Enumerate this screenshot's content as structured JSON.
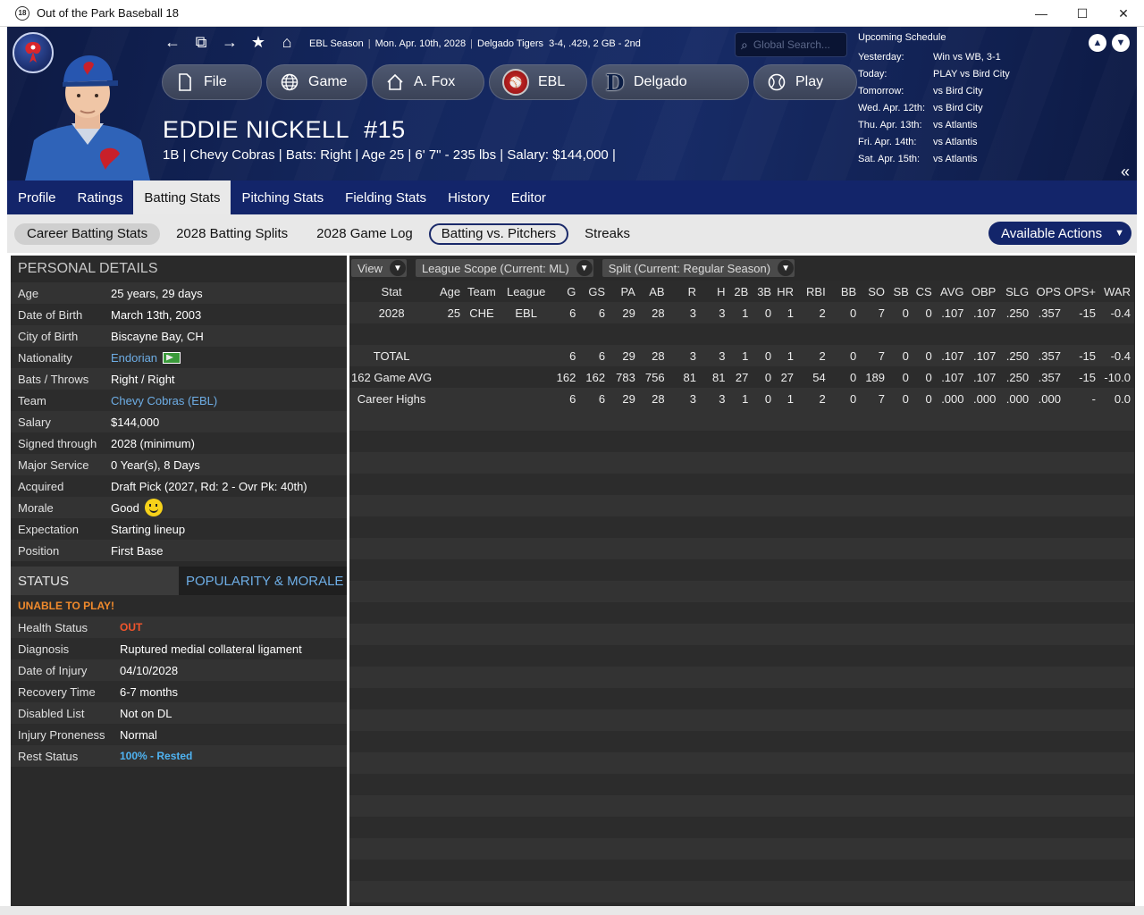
{
  "window": {
    "title": "Out of the Park Baseball 18",
    "app_badge": "18",
    "minimize": "—",
    "maximize": "☐",
    "close": "✕"
  },
  "header": {
    "season_label": "EBL Season",
    "date": "Mon. Apr. 10th, 2028",
    "team": "Delgado Tigers",
    "record": "3-4, .429, 2 GB - 2nd",
    "search_placeholder": "Global Search...",
    "menu": [
      {
        "label": "File",
        "icon": "file-icon"
      },
      {
        "label": "Game",
        "icon": "globe-icon"
      },
      {
        "label": "A. Fox",
        "icon": "home-icon"
      },
      {
        "label": "EBL",
        "icon": "league-logo-icon"
      },
      {
        "label": "Delgado",
        "icon": "tigers-logo-icon"
      },
      {
        "label": "Play",
        "icon": "baseball-icon"
      }
    ]
  },
  "player": {
    "name": "EDDIE NICKELL",
    "number": "#15",
    "info": "1B | Chevy Cobras  |  Bats: Right  |  Age 25  |  6' 7\" - 235 lbs  |  Salary: $144,000  |"
  },
  "schedule": {
    "title": "Upcoming Schedule",
    "rows": [
      {
        "day": "Yesterday:",
        "game": "Win vs WB, 3-1"
      },
      {
        "day": "Today:",
        "game": "PLAY vs Bird City"
      },
      {
        "day": "Tomorrow:",
        "game": "vs Bird City"
      },
      {
        "day": "Wed. Apr. 12th:",
        "game": "vs Bird City"
      },
      {
        "day": "Thu. Apr. 13th:",
        "game": "vs Atlantis"
      },
      {
        "day": "Fri. Apr. 14th:",
        "game": "vs Atlantis"
      },
      {
        "day": "Sat. Apr. 15th:",
        "game": "vs Atlantis"
      }
    ]
  },
  "tabs": [
    "Profile",
    "Ratings",
    "Batting Stats",
    "Pitching Stats",
    "Fielding Stats",
    "History",
    "Editor"
  ],
  "active_tab": "Batting Stats",
  "subtabs": [
    "Career Batting Stats",
    "2028 Batting Splits",
    "2028 Game Log",
    "Batting vs. Pitchers",
    "Streaks"
  ],
  "available_actions": "Available Actions",
  "personal": {
    "title": "PERSONAL DETAILS",
    "rows": [
      {
        "label": "Age",
        "value": "25 years, 29 days"
      },
      {
        "label": "Date of Birth",
        "value": "March 13th, 2003"
      },
      {
        "label": "City of Birth",
        "value": "Biscayne Bay, CH"
      },
      {
        "label": "Nationality",
        "value": "Endorian"
      },
      {
        "label": "Bats / Throws",
        "value": "Right / Right"
      },
      {
        "label": "Team",
        "value": "Chevy Cobras (EBL)"
      },
      {
        "label": "Salary",
        "value": "$144,000"
      },
      {
        "label": "Signed through",
        "value": "2028 (minimum)"
      },
      {
        "label": "Major Service",
        "value": "0 Year(s), 8 Days"
      },
      {
        "label": "Acquired",
        "value": "Draft Pick (2027, Rd: 2 - Ovr Pk: 40th)"
      },
      {
        "label": "Morale",
        "value": "Good"
      },
      {
        "label": "Expectation",
        "value": "Starting lineup"
      },
      {
        "label": "Position",
        "value": "First Base"
      }
    ]
  },
  "status": {
    "tab_status": "STATUS",
    "tab_popularity": "POPULARITY & MORALE",
    "alert": "UNABLE TO PLAY!",
    "rows": [
      {
        "label": "Health Status",
        "value": "OUT"
      },
      {
        "label": "Diagnosis",
        "value": "Ruptured medial collateral ligament"
      },
      {
        "label": "Date of Injury",
        "value": "04/10/2028"
      },
      {
        "label": "Recovery Time",
        "value": "6-7 months"
      },
      {
        "label": "Disabled List",
        "value": "Not on DL"
      },
      {
        "label": "Injury Proneness",
        "value": "Normal"
      },
      {
        "label": "Rest Status",
        "value": "100% - Rested"
      }
    ]
  },
  "filters": {
    "view": "View",
    "scope": "League Scope  (Current: ML)",
    "split": "Split  (Current: Regular Season)"
  },
  "stats": {
    "columns": [
      "Stat",
      "Age",
      "Team",
      "League",
      "G",
      "GS",
      "PA",
      "AB",
      "R",
      "H",
      "2B",
      "3B",
      "HR",
      "RBI",
      "BB",
      "SO",
      "SB",
      "CS",
      "AVG",
      "OBP",
      "SLG",
      "OPS",
      "OPS+",
      "WAR"
    ],
    "rows": [
      [
        "2028",
        "25",
        "CHE",
        "EBL",
        "6",
        "6",
        "29",
        "28",
        "3",
        "3",
        "1",
        "0",
        "1",
        "2",
        "0",
        "7",
        "0",
        "0",
        ".107",
        ".107",
        ".250",
        ".357",
        "-15",
        "-0.4"
      ],
      [
        "",
        "",
        "",
        "",
        "",
        "",
        "",
        "",
        "",
        "",
        "",
        "",
        "",
        "",
        "",
        "",
        "",
        "",
        "",
        "",
        "",
        "",
        "",
        ""
      ],
      [
        "TOTAL",
        "",
        "",
        "",
        "6",
        "6",
        "29",
        "28",
        "3",
        "3",
        "1",
        "0",
        "1",
        "2",
        "0",
        "7",
        "0",
        "0",
        ".107",
        ".107",
        ".250",
        ".357",
        "-15",
        "-0.4"
      ],
      [
        "162 Game AVG",
        "",
        "",
        "",
        "162",
        "162",
        "783",
        "756",
        "81",
        "81",
        "27",
        "0",
        "27",
        "54",
        "0",
        "189",
        "0",
        "0",
        ".107",
        ".107",
        ".250",
        ".357",
        "-15",
        "-10.0"
      ],
      [
        "Career Highs",
        "",
        "",
        "",
        "6",
        "6",
        "29",
        "28",
        "3",
        "3",
        "1",
        "0",
        "1",
        "2",
        "0",
        "7",
        "0",
        "0",
        ".000",
        ".000",
        ".000",
        ".000",
        "-",
        "0.0"
      ]
    ]
  }
}
